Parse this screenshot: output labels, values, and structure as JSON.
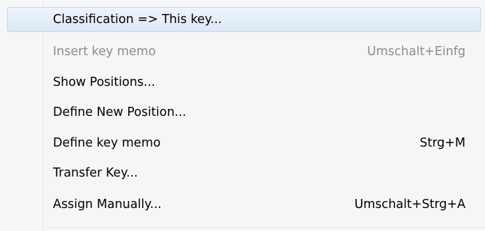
{
  "menu": {
    "items": [
      {
        "label": "Classification => This key...",
        "shortcut": "",
        "enabled": true,
        "highlighted": true
      },
      {
        "label": "Insert key memo",
        "shortcut": "Umschalt+Einfg",
        "enabled": false,
        "highlighted": false
      },
      {
        "label": "Show Positions...",
        "shortcut": "",
        "enabled": true,
        "highlighted": false
      },
      {
        "label": "Define New Position...",
        "shortcut": "",
        "enabled": true,
        "highlighted": false
      },
      {
        "label": "Define key memo",
        "shortcut": "Strg+M",
        "enabled": true,
        "highlighted": false
      },
      {
        "label": "Transfer Key...",
        "shortcut": "",
        "enabled": true,
        "highlighted": false
      },
      {
        "label": "Assign Manually...",
        "shortcut": "Umschalt+Strg+A",
        "enabled": true,
        "highlighted": false
      }
    ]
  },
  "colors": {
    "menu_background": "#f5f6f7",
    "highlight_fill": "#dde8f6",
    "highlight_border": "#c6d6ec",
    "disabled_text": "#8c8c8c",
    "text": "#000000"
  }
}
